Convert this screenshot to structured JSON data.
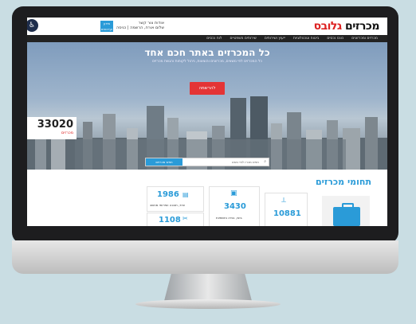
{
  "site": {
    "logo_left": "גלובס",
    "logo_right": "מכרזים",
    "header_links": "שלום אורח, הרשמה | כניסה",
    "header_links_top": "אודות  צור קשר",
    "header_button": "מידע ועדכונים",
    "accessibility_icon": "accessibility-icon"
  },
  "nav": {
    "items": [
      "מכרזים ומכרזונים",
      "כונס נכסים",
      "ביטוח וטכנולוגיות",
      "ייעוץ ושירותים",
      "שירותים משפטיים",
      "לוח נכסים"
    ]
  },
  "hero": {
    "title": "כל המכרזים באתר חכם אחד",
    "subtitle": "כל המכרזים לפי נושאים, מכרזונים והוצאות, ניהול לקוחות והגשת מכרזים",
    "cta": "להרשמה",
    "counter_number": "33020",
    "counter_label": "מכרזים"
  },
  "search": {
    "placeholder": "חפש מכרז לפי נושא",
    "button": "חפש מכרזים"
  },
  "categories": {
    "title": "תחומי מכרזים",
    "cards": [
      {
        "num": "1986",
        "label": "ציוד, תוכנה ושירותי מחשב"
      },
      {
        "num": "3430",
        "label": "בינוי, בנייה ותשתיות"
      },
      {
        "num": "10881",
        "label": ""
      },
      {
        "num": "1108",
        "label": ""
      }
    ]
  }
}
